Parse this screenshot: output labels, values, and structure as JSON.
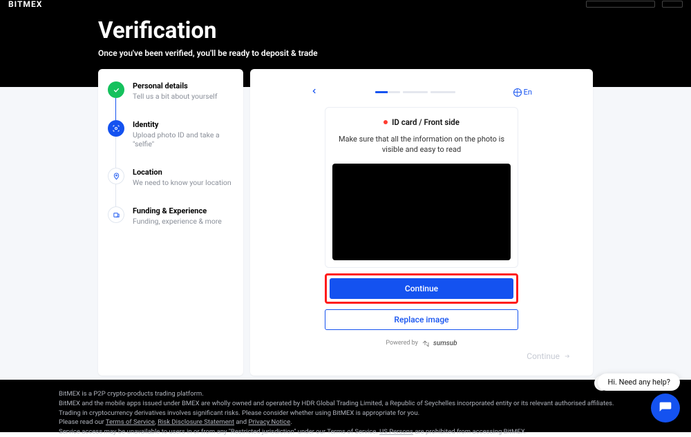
{
  "brand": "BITMEX",
  "header": {
    "title": "Verification",
    "subtitle": "Once you've been verified, you'll be ready to deposit & trade"
  },
  "steps": [
    {
      "title": "Personal details",
      "sub": "Tell us a bit about yourself"
    },
    {
      "title": "Identity",
      "sub": "Upload photo ID and take a \"selfie\""
    },
    {
      "title": "Location",
      "sub": "We need to know your location"
    },
    {
      "title": "Funding & Experience",
      "sub": "Funding, experience & more"
    }
  ],
  "modal": {
    "lang": "En",
    "card_title": "ID card / Front side",
    "instruction": "Make sure that all the information on the photo is visible and easy to read",
    "continue_btn": "Continue",
    "replace_btn": "Replace image",
    "powered_prefix": "Powered by",
    "powered_brand": "sumsub"
  },
  "corner_continue": "Continue",
  "footer": {
    "l1": "BitMEX is a P2P crypto-products trading platform.",
    "l2": "BitMEX and the mobile apps issued under BMEX are wholly owned and operated by HDR Global Trading Limited, a Republic of Seychelles incorporated entity or its relevant authorised affiliates.",
    "l3": "Trading in cryptocurrency derivatives involves significant risks. Please consider whether using BitMEX is appropriate for you.",
    "l4_prefix": "Please read our ",
    "l4_link1": "Terms of Service",
    "l4_sep1": ", ",
    "l4_link2": "Risk Disclosure Statement",
    "l4_sep2": " and ",
    "l4_link3": "Privacy Notice",
    "l4_suffix": ".",
    "l5_prefix": "Service access may be unavailable to users in or from any \"Restricted jurisdiction\" under our Terms of Service. ",
    "l5_link": "US Persons",
    "l5_suffix": " are prohibited from accessing BitMEX."
  },
  "chat": {
    "prompt": "Hi. Need any help?"
  }
}
